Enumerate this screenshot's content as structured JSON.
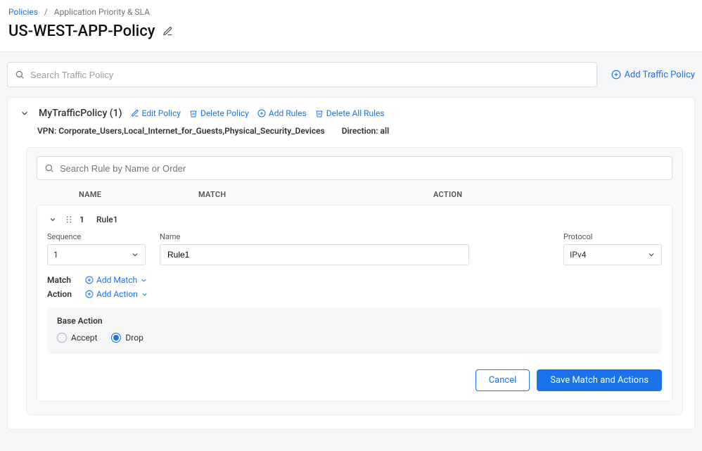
{
  "breadcrumb": {
    "root": "Policies",
    "separator": "/",
    "current": "Application Priority & SLA"
  },
  "page_title": "US-WEST-APP-Policy",
  "search": {
    "main_placeholder": "Search Traffic Policy",
    "rule_placeholder": "Search Rule by Name or Order"
  },
  "actions": {
    "add_traffic_policy": "Add Traffic Policy",
    "edit_policy": "Edit Policy",
    "delete_policy": "Delete Policy",
    "add_rules": "Add Rules",
    "delete_all_rules": "Delete All Rules",
    "add_match": "Add Match",
    "add_action": "Add Action"
  },
  "policy": {
    "name": "MyTrafficPolicy",
    "count": "(1)",
    "meta": {
      "vpn_label": "VPN:",
      "vpn_value": "Corporate_Users,Local_Internet_for_Guests,Physical_Security_Devices",
      "direction_label": "Direction:",
      "direction_value": "all"
    }
  },
  "columns": {
    "name": "NAME",
    "match": "MATCH",
    "action": "ACTION"
  },
  "rule": {
    "order": "1",
    "display_name": "Rule1",
    "fields": {
      "sequence_label": "Sequence",
      "sequence_value": "1",
      "name_label": "Name",
      "name_value": "Rule1",
      "protocol_label": "Protocol",
      "protocol_value": "IPv4"
    },
    "sections": {
      "match_label": "Match",
      "action_label": "Action"
    },
    "base_action": {
      "title": "Base Action",
      "accept": "Accept",
      "drop": "Drop",
      "selected": "Drop"
    }
  },
  "footer": {
    "cancel": "Cancel",
    "save": "Save Match and Actions"
  }
}
